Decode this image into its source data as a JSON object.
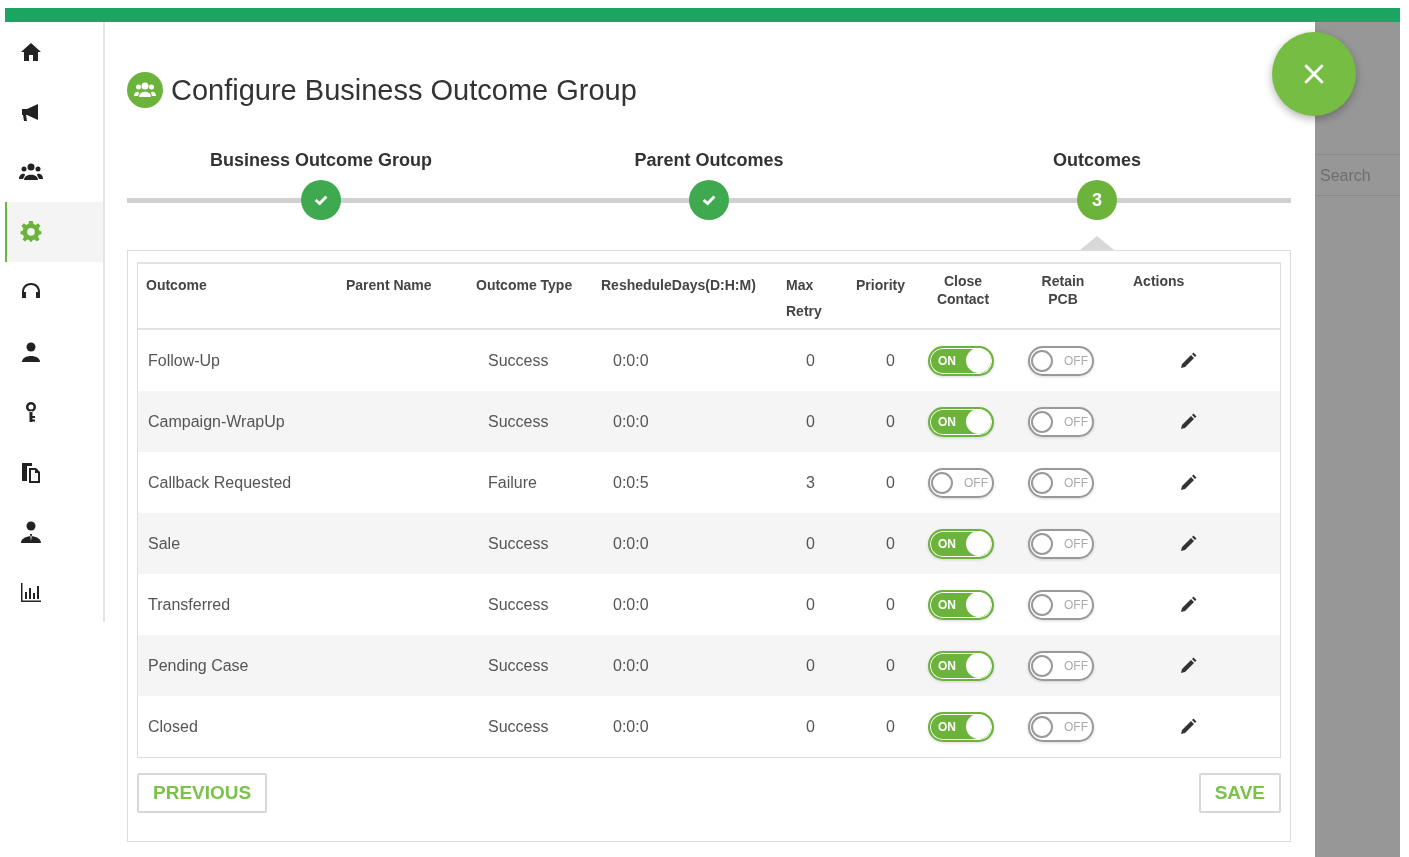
{
  "sidebar": {
    "items": [
      {
        "selected": false
      },
      {
        "selected": false
      },
      {
        "selected": false
      },
      {
        "selected": true
      },
      {
        "selected": false
      },
      {
        "selected": false
      },
      {
        "selected": false
      },
      {
        "selected": false
      },
      {
        "selected": false
      },
      {
        "selected": false
      }
    ]
  },
  "background": {
    "search": {
      "placeholder": "Search"
    }
  },
  "dialog": {
    "title": "Configure Business Outcome Group",
    "steps": [
      {
        "label": "Business Outcome Group",
        "completed": true
      },
      {
        "label": "Parent Outcomes",
        "completed": true
      },
      {
        "label": "Outcomes",
        "completed": false,
        "number": "3"
      }
    ],
    "table": {
      "columns": [
        "Outcome",
        "Parent Name",
        "Outcome Type",
        "ResheduleDays(D:H:M)",
        "Max Retry",
        "Priority",
        "Close Contact",
        "Retain PCB",
        "Actions"
      ],
      "rows": [
        {
          "outcome": "Follow-Up",
          "outcome_type": "Success",
          "reschedule": "0:0:0",
          "max_retry": "0",
          "priority": "0",
          "close_contact": {
            "on": true,
            "label": "ON"
          },
          "retain_pcb": {
            "on": false,
            "label": "OFF"
          }
        },
        {
          "outcome": "Campaign-WrapUp",
          "outcome_type": "Success",
          "reschedule": "0:0:0",
          "max_retry": "0",
          "priority": "0",
          "close_contact": {
            "on": true,
            "label": "ON"
          },
          "retain_pcb": {
            "on": false,
            "label": "OFF"
          }
        },
        {
          "outcome": "Callback Requested",
          "outcome_type": "Failure",
          "reschedule": "0:0:5",
          "max_retry": "3",
          "priority": "0",
          "close_contact": {
            "on": false,
            "label": "OFF"
          },
          "retain_pcb": {
            "on": false,
            "label": "OFF"
          }
        },
        {
          "outcome": "Sale",
          "outcome_type": "Success",
          "reschedule": "0:0:0",
          "max_retry": "0",
          "priority": "0",
          "close_contact": {
            "on": true,
            "label": "ON"
          },
          "retain_pcb": {
            "on": false,
            "label": "OFF"
          }
        },
        {
          "outcome": "Transferred",
          "outcome_type": "Success",
          "reschedule": "0:0:0",
          "max_retry": "0",
          "priority": "0",
          "close_contact": {
            "on": true,
            "label": "ON"
          },
          "retain_pcb": {
            "on": false,
            "label": "OFF"
          }
        },
        {
          "outcome": "Pending Case",
          "outcome_type": "Success",
          "reschedule": "0:0:0",
          "max_retry": "0",
          "priority": "0",
          "close_contact": {
            "on": true,
            "label": "ON"
          },
          "retain_pcb": {
            "on": false,
            "label": "OFF"
          }
        },
        {
          "outcome": "Closed",
          "outcome_type": "Success",
          "reschedule": "0:0:0",
          "max_retry": "0",
          "priority": "0",
          "close_contact": {
            "on": true,
            "label": "ON"
          },
          "retain_pcb": {
            "on": false,
            "label": "OFF"
          }
        }
      ]
    },
    "buttons": {
      "previous": "PREVIOUS",
      "save": "SAVE"
    }
  }
}
